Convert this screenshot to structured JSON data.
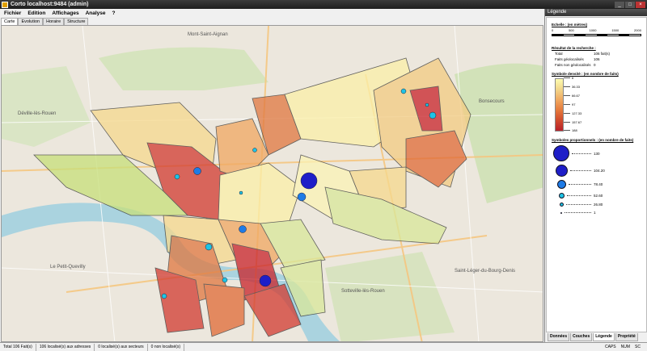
{
  "window": {
    "title": "Corto localhost:9484 (admin)"
  },
  "menu": [
    "Fichier",
    "Edition",
    "Affichages",
    "Analyse",
    "?"
  ],
  "tabs": [
    "Carte",
    "Evolution",
    "Horaire",
    "Structure"
  ],
  "map": {
    "watermark": "corto",
    "place_labels": [
      "Mont-Saint-Aignan",
      "Déville-lès-Rouen",
      "Le Petit-Quevilly",
      "Sotteville-lès-Rouen",
      "Bonsecours",
      "Saint-Léger-du-Bourg-Denis"
    ]
  },
  "panel": {
    "title": "Légende",
    "scale": {
      "title": "Echelle : (en mètres)",
      "ticks": [
        "0",
        "500",
        "1000",
        "1500",
        "2000"
      ]
    },
    "result": {
      "title": "Résultat de la recherche :",
      "rows": [
        {
          "k": "Total",
          "v": "106 fait(s)"
        },
        {
          "k": "Faits géolocalisés",
          "v": "106"
        },
        {
          "k": "Faits non géolocalisés",
          "v": "0"
        }
      ]
    },
    "density": {
      "title": "Symbole densité : (en nombre de faits)",
      "ticks": [
        "6",
        "36.33",
        "66.67",
        "97",
        "127.33",
        "157.67",
        "188"
      ]
    },
    "proportional": {
      "title": "Symboles proportionnels : (en nombre de faits)",
      "values": [
        "130",
        "104.20",
        "78.40",
        "52.60",
        "26.80",
        "1"
      ]
    },
    "tabs": [
      "Données",
      "Couches",
      "Légende",
      "Propriété"
    ]
  },
  "status": {
    "total": "Total 106 Fait(s)",
    "localises": "106 localisé(s) aux adresses",
    "secteurs": "0 localisé(s) aux secteurs",
    "non": "0 non localisé(s)",
    "indicators": [
      "CAPS",
      "NUM",
      "SC"
    ]
  }
}
